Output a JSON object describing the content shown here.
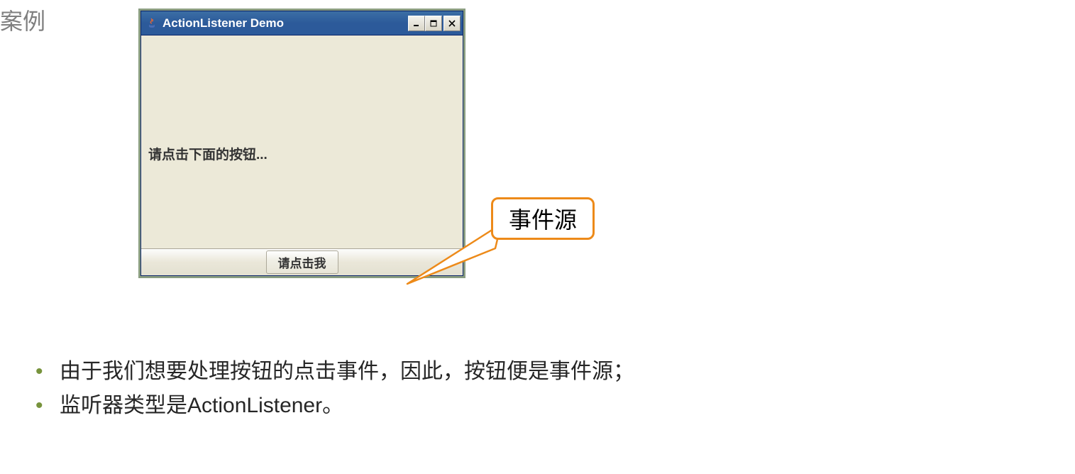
{
  "heading": "案例",
  "window": {
    "title": "ActionListener Demo",
    "label_text": "请点击下面的按钮...",
    "button_label": "请点击我"
  },
  "callout": {
    "label": "事件源"
  },
  "bullets": [
    "由于我们想要处理按钮的点击事件，因此，按钮便是事件源；",
    "监听器类型是ActionListener。"
  ]
}
